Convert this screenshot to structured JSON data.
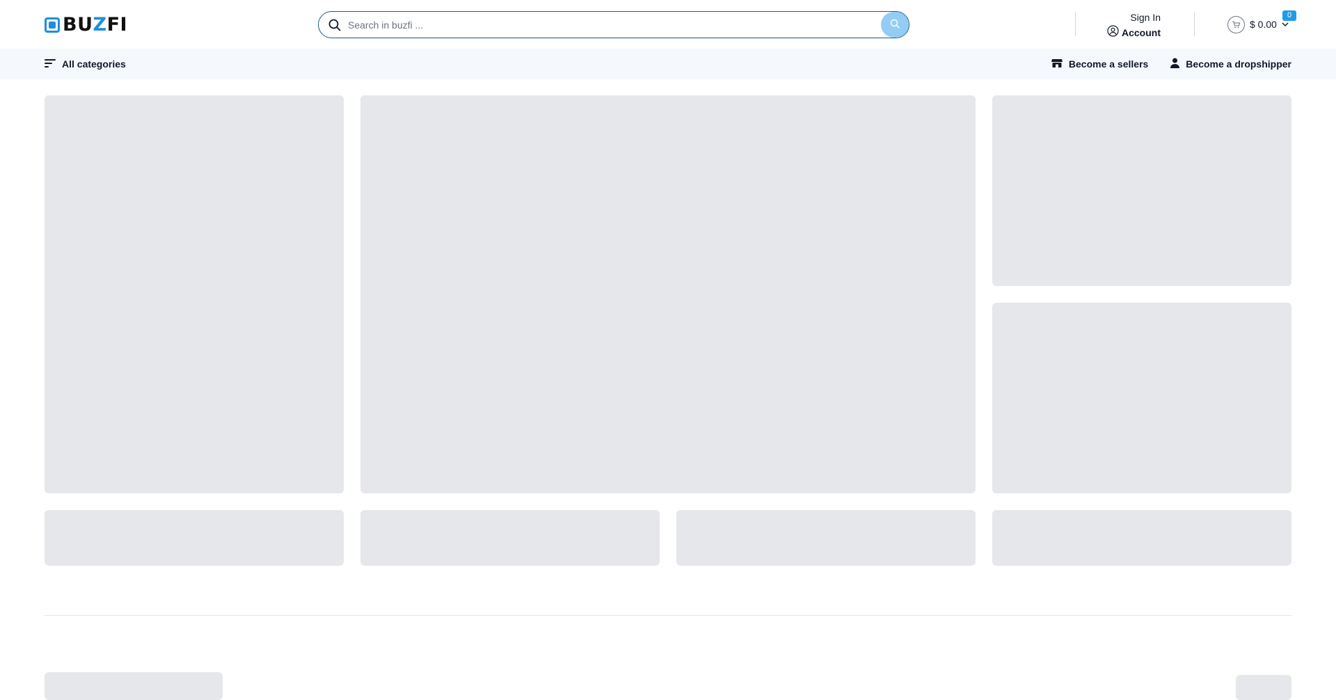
{
  "header": {
    "logo": {
      "text_left": "BU",
      "text_z": "Z",
      "text_right": "FI"
    },
    "search": {
      "placeholder": "Search in buzfi ..."
    },
    "account": {
      "signin_label": "Sign In",
      "account_label": "Account"
    },
    "cart": {
      "total": "$ 0.00",
      "count": "0"
    }
  },
  "navbar": {
    "categories_label": "All categories",
    "links": {
      "seller": "Become a sellers",
      "dropshipper": "Become a dropshipper"
    }
  },
  "icons": {
    "menu": "menu-icon",
    "search": "search-icon",
    "user": "user-circle-icon",
    "cart": "cart-icon",
    "chevron": "chevron-down-icon",
    "store": "store-icon",
    "person": "person-icon"
  },
  "colors": {
    "brand": "#1f8fd8",
    "search_button": "#93cdf5",
    "badge": "#1f9be8",
    "navbar_bg": "#f5f9fe",
    "skeleton": "#e5e7eb"
  }
}
